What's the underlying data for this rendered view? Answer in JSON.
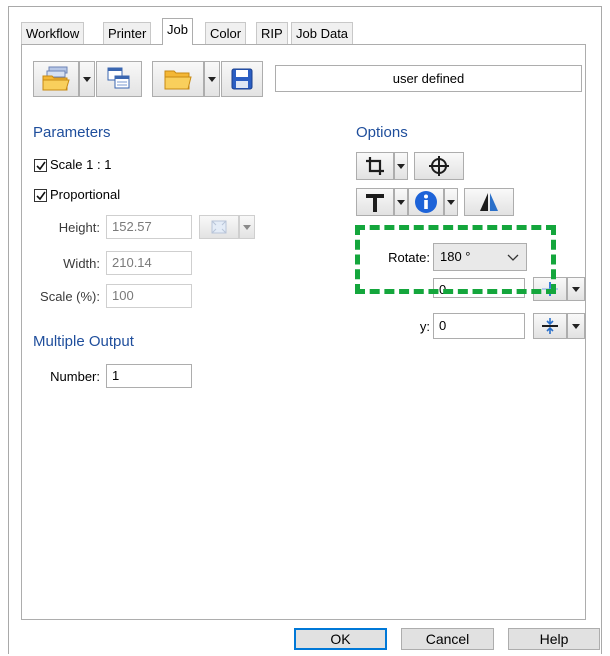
{
  "tabs": [
    "Workflow",
    "Printer",
    "Job",
    "Color",
    "RIP",
    "Job Data"
  ],
  "active_tab": "Job",
  "toolbar": {
    "preset_value": "user defined"
  },
  "parameters": {
    "title": "Parameters",
    "scale_1_1_label": "Scale 1 : 1",
    "scale_1_1_checked": true,
    "proportional_label": "Proportional",
    "proportional_checked": true,
    "height_label": "Height:",
    "height_value": "152.57",
    "width_label": "Width:",
    "width_value": "210.14",
    "scale_pct_label": "Scale (%):",
    "scale_pct_value": "100"
  },
  "multiple_output": {
    "title": "Multiple Output",
    "number_label": "Number:",
    "number_value": "1"
  },
  "options": {
    "title": "Options",
    "rotate_label": "Rotate:",
    "rotate_value": "180 °",
    "offset_y_label": "y:",
    "offset_y_value": "0",
    "offset_x_value": "0"
  },
  "buttons": {
    "ok": "OK",
    "cancel": "Cancel",
    "help": "Help"
  },
  "colors": {
    "accent_blue": "#1f4e9c",
    "highlight_green": "#14a63c",
    "default_button": "#0078d7"
  }
}
